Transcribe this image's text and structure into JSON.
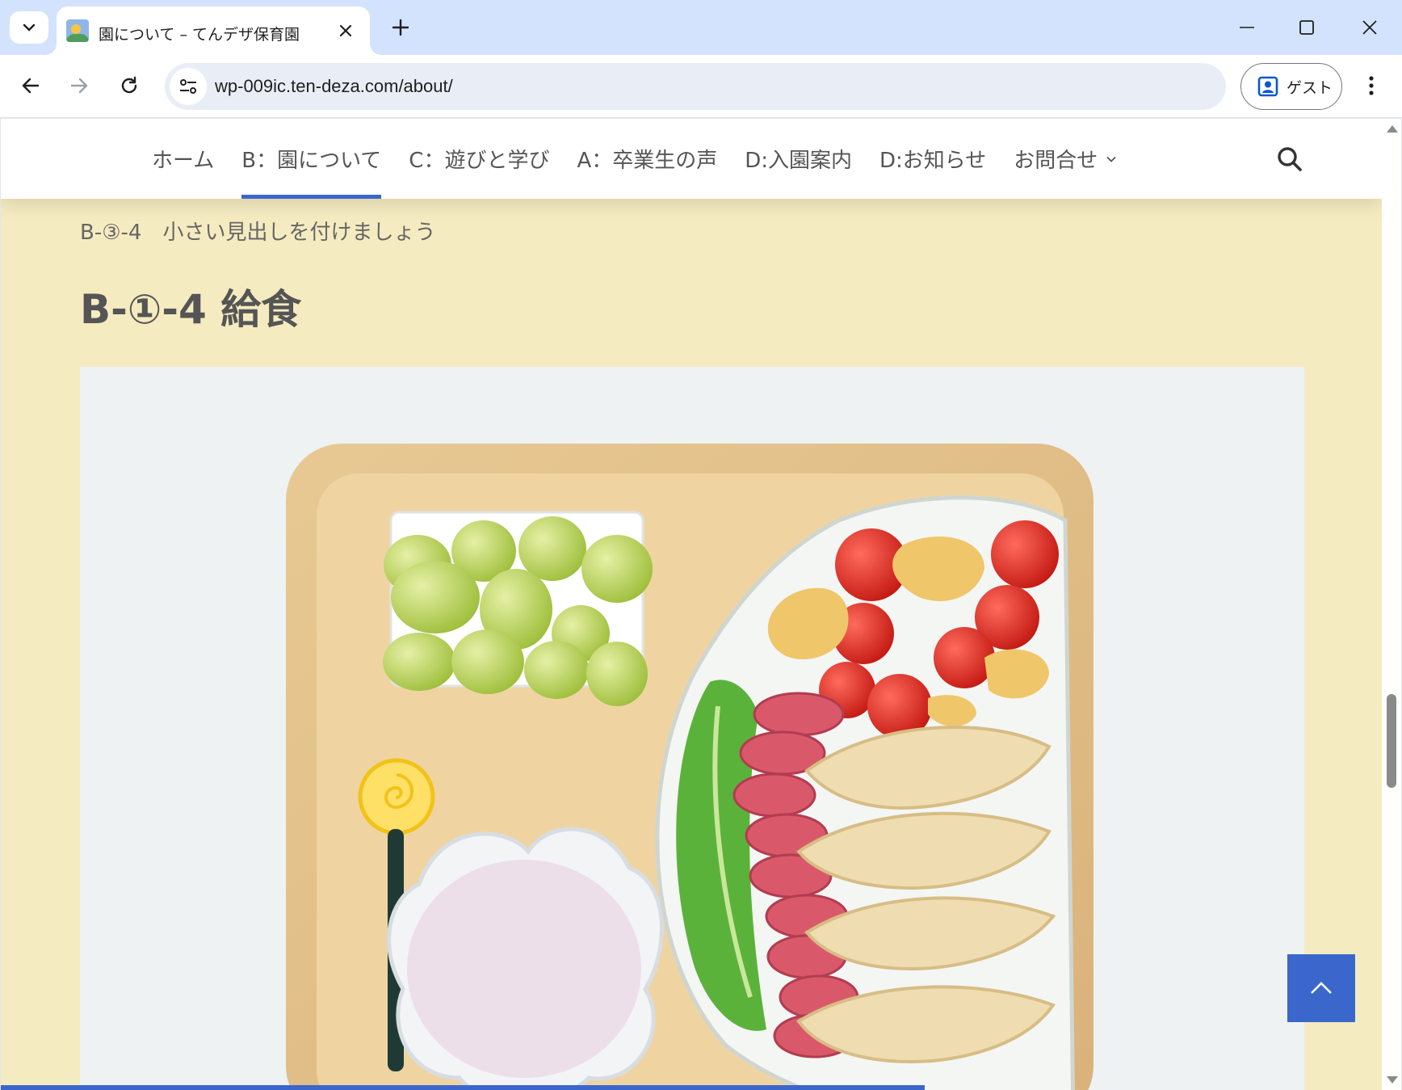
{
  "browser": {
    "tab": {
      "title": "園について – てんデザ保育園"
    },
    "url": "wp-009ic.ten-deza.com/about/",
    "profile_label": "ゲスト"
  },
  "site": {
    "nav": {
      "items": [
        {
          "label": "ホーム",
          "active": false
        },
        {
          "label": "B：園について",
          "active": true
        },
        {
          "label": "C：遊びと学び",
          "active": false
        },
        {
          "label": "A：卒業生の声",
          "active": false
        },
        {
          "label": "D:入園案内",
          "active": false
        },
        {
          "label": "D:お知らせ",
          "active": false
        },
        {
          "label": "お問合せ",
          "active": false,
          "has_dropdown": true
        }
      ]
    },
    "subheading": "B-③-4　小さい見出しを付けましょう",
    "heading": "B-①-4 給食",
    "accent_color": "#3b66cc",
    "background_color": "#f5ebc0"
  },
  "scroll_progress_percent": 66
}
